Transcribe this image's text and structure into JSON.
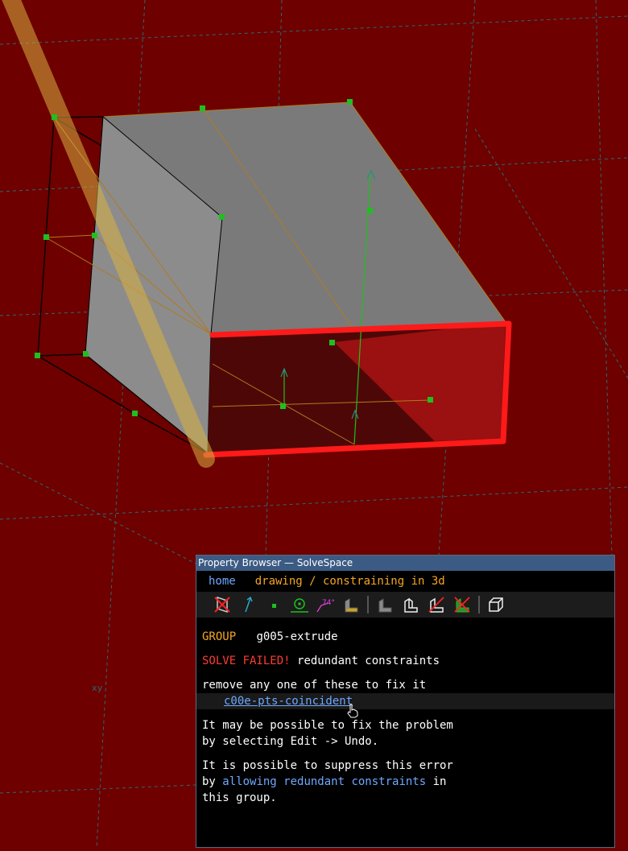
{
  "window": {
    "title": "Property Browser — SolveSpace"
  },
  "nav": {
    "home": "home",
    "breadcrumb": "drawing / constraining in 3d"
  },
  "toolbar": {
    "icons": [
      "workplane-icon",
      "normal-icon",
      "point-icon",
      "circle-icon",
      "angle-icon",
      "shaded-icon",
      "solid-shaded-icon",
      "outline-icon",
      "hidden-lines-icon",
      "mesh-icon",
      "cube-icon"
    ]
  },
  "group": {
    "label": "GROUP",
    "name": "g005-extrude"
  },
  "error": {
    "status": "SOLVE FAILED!",
    "message": "redundant constraints"
  },
  "fix": {
    "instruction": "remove any one of these to fix it",
    "constraint": "c00e-pts-coincident"
  },
  "undo": {
    "line1": "It may be possible to fix the problem",
    "line2": "by selecting Edit -> Undo."
  },
  "suppress": {
    "line1": "It is possible to suppress this error",
    "line2_prefix": "by ",
    "link": "allowing redundant constraints",
    "line2_suffix": " in",
    "line3": "this group."
  },
  "viewport": {
    "axis_label": "xy",
    "background": "#6e0000"
  }
}
